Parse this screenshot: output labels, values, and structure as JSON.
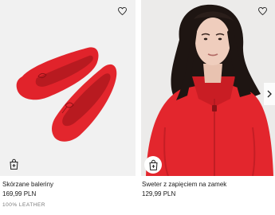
{
  "products": [
    {
      "title": "Skórzane baleriny",
      "price": "169,99 PLN",
      "material": "100% LEATHER",
      "image_icon": "red-ballet-flats-image"
    },
    {
      "title": "Sweter z zapięciem na zamek",
      "price": "129,99 PLN",
      "image_icon": "woman-red-zip-sweater-image"
    }
  ],
  "colors": {
    "product_red": "#e3262d",
    "secondary_text": "#777777"
  }
}
